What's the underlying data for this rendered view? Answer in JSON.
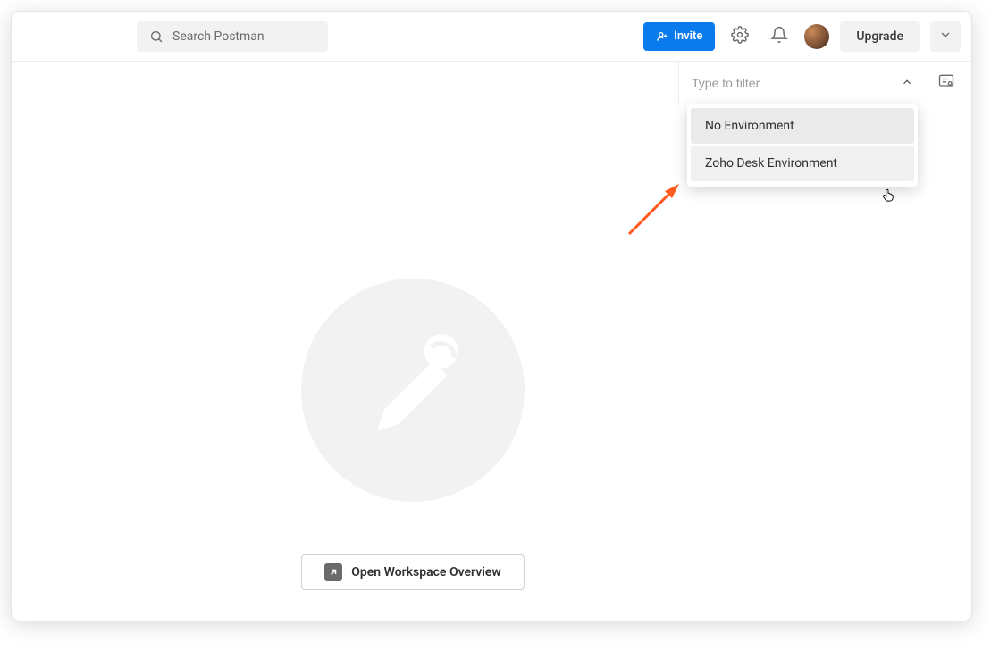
{
  "header": {
    "search_placeholder": "Search Postman",
    "invite_label": "Invite",
    "upgrade_label": "Upgrade"
  },
  "env": {
    "filter_placeholder": "Type to filter",
    "items": [
      {
        "label": "No Environment"
      },
      {
        "label": "Zoho Desk Environment"
      }
    ]
  },
  "main": {
    "overview_label": "Open Workspace Overview"
  },
  "colors": {
    "accent": "#097bed",
    "annotation": "#ff5b1f"
  }
}
